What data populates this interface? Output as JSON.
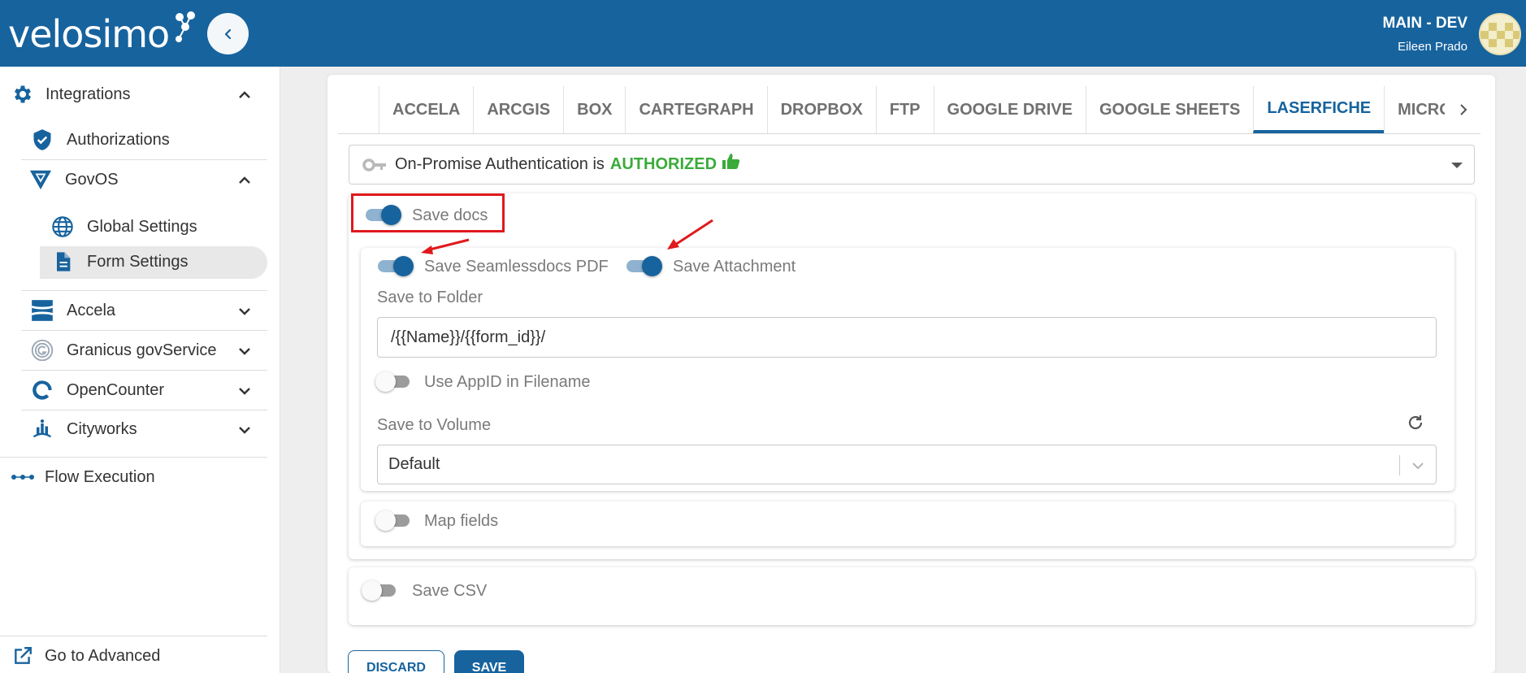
{
  "header": {
    "logo_text": "velosimo",
    "environment": "MAIN - DEV",
    "user_name": "Eileen Prado",
    "bar_color": "#17639e"
  },
  "sidebar": {
    "integrations": "Integrations",
    "authorizations": "Authorizations",
    "govos": "GovOS",
    "global_settings": "Global Settings",
    "form_settings": "Form Settings",
    "accela": "Accela",
    "granicus": "Granicus govService",
    "opencounter": "OpenCounter",
    "cityworks": "Cityworks",
    "flow_execution": "Flow Execution",
    "go_to_advanced": "Go to Advanced"
  },
  "tabs": [
    "ACCELA",
    "ARCGIS",
    "BOX",
    "CARTEGRAPH",
    "DROPBOX",
    "FTP",
    "GOOGLE DRIVE",
    "GOOGLE SHEETS",
    "LASERFICHE",
    "MICRO"
  ],
  "active_tab": "LASERFICHE",
  "auth": {
    "prefix": "On-Promise Authentication is",
    "status": "AUTHORIZED",
    "status_color": "#3aab3a"
  },
  "form": {
    "save_docs_label": "Save docs",
    "save_docs_on": true,
    "save_pdf_label": "Save Seamlessdocs PDF",
    "save_pdf_on": true,
    "save_attachment_label": "Save Attachment",
    "save_attachment_on": true,
    "save_to_folder_label": "Save to Folder",
    "save_to_folder_value": "/{{Name}}/{{form_id}}/",
    "use_appid_label": "Use AppID in Filename",
    "use_appid_on": false,
    "save_to_volume_label": "Save to Volume",
    "volume_value": "Default",
    "map_fields_label": "Map fields",
    "map_fields_on": false,
    "save_csv_label": "Save CSV",
    "save_csv_on": false
  },
  "buttons": {
    "discard": "DISCARD",
    "save": "SAVE"
  },
  "icons": {
    "collapse": "chevron-left-icon",
    "key": "key-icon",
    "thumbs_up": "thumbs-up-icon",
    "refresh": "refresh-icon",
    "external": "external-link-icon"
  }
}
